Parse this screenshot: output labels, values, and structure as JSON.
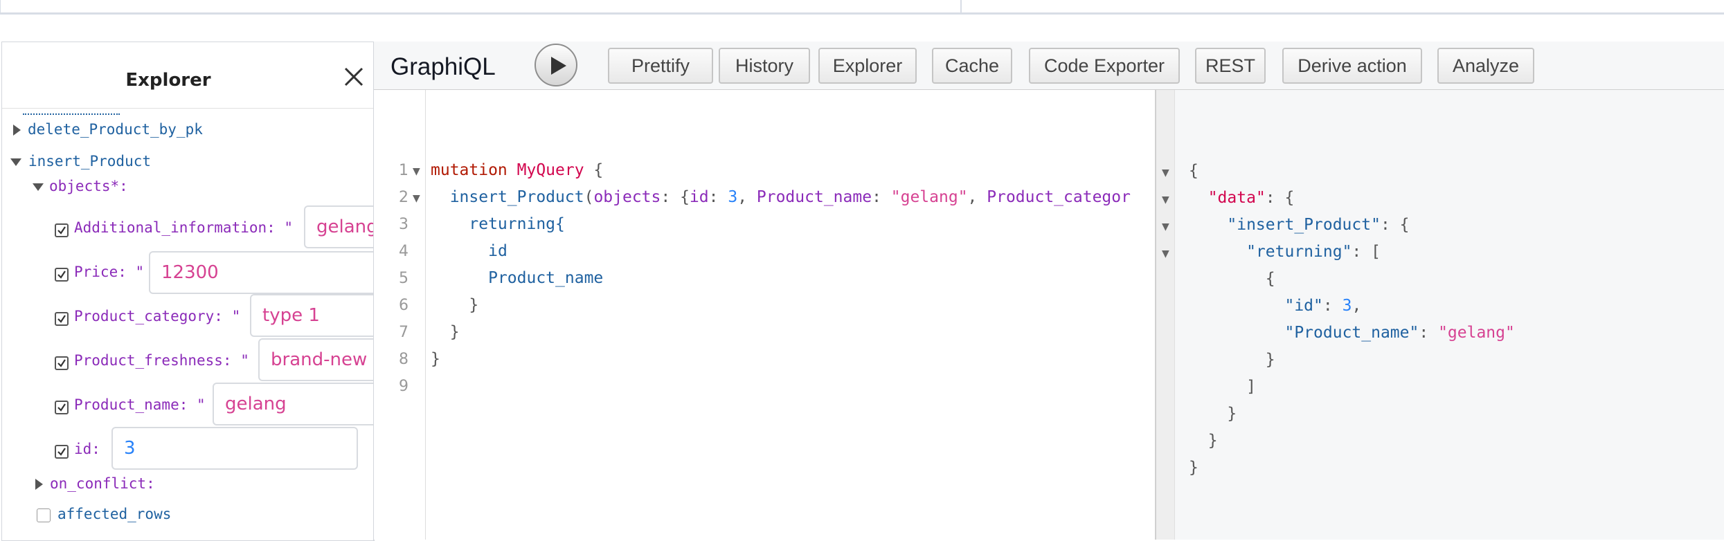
{
  "explorer": {
    "title": "Explorer",
    "items": {
      "delete": "delete_Product_by_pk",
      "insert": "insert_Product",
      "objects": "objects*:",
      "on_conflict": "on_conflict:",
      "affected_rows": "affected_rows"
    },
    "fields": [
      {
        "label": "Additional_information: \"",
        "value": "gelang"
      },
      {
        "label": "Price: \"",
        "value": "12300"
      },
      {
        "label": "Product_category: \"",
        "value": "type 1"
      },
      {
        "label": "Product_freshness: \"",
        "value": "brand-new"
      },
      {
        "label": "Product_name: \"",
        "value": "gelang"
      },
      {
        "label": "id:",
        "value": "3"
      }
    ]
  },
  "graphiql": {
    "title": "GraphiQL",
    "buttons": {
      "prettify": "Prettify",
      "history": "History",
      "explorer": "Explorer",
      "cache": "Cache",
      "code_exporter": "Code Exporter",
      "rest": "REST",
      "derive_action": "Derive action",
      "analyze": "Analyze"
    }
  },
  "editor": {
    "line_numbers": [
      "1",
      "2",
      "3",
      "4",
      "5",
      "6",
      "7",
      "8",
      "9"
    ],
    "tokens": {
      "mutation": "mutation",
      "op_name": "MyQuery",
      "brace_open": " {",
      "insert_field": "insert_Product",
      "paren_open": "(",
      "objects_arg": "objects",
      "colon_brace": ": {",
      "id_key": "id",
      "colon_sp": ": ",
      "id_val": "3",
      "comma_sp": ", ",
      "pname_key": "Product_name",
      "pname_val": "\"gelang\"",
      "pcat_key": "Product_categor",
      "returning": "returning{",
      "id_field": "id",
      "pname_field": "Product_name",
      "close_brace": "}"
    }
  },
  "result": {
    "tokens": {
      "open_brace": "{",
      "data_key": "\"data\"",
      "colon_brace": ": {",
      "insert_key": "\"insert_Product\"",
      "returning_key": "\"returning\"",
      "colon_bracket": ": [",
      "id_key": "\"id\"",
      "colon_sp": ": ",
      "id_val": "3",
      "comma": ",",
      "pname_key": "\"Product_name\"",
      "pname_val": "\"gelang\"",
      "close_brace": "}",
      "close_bracket": "]"
    }
  }
}
